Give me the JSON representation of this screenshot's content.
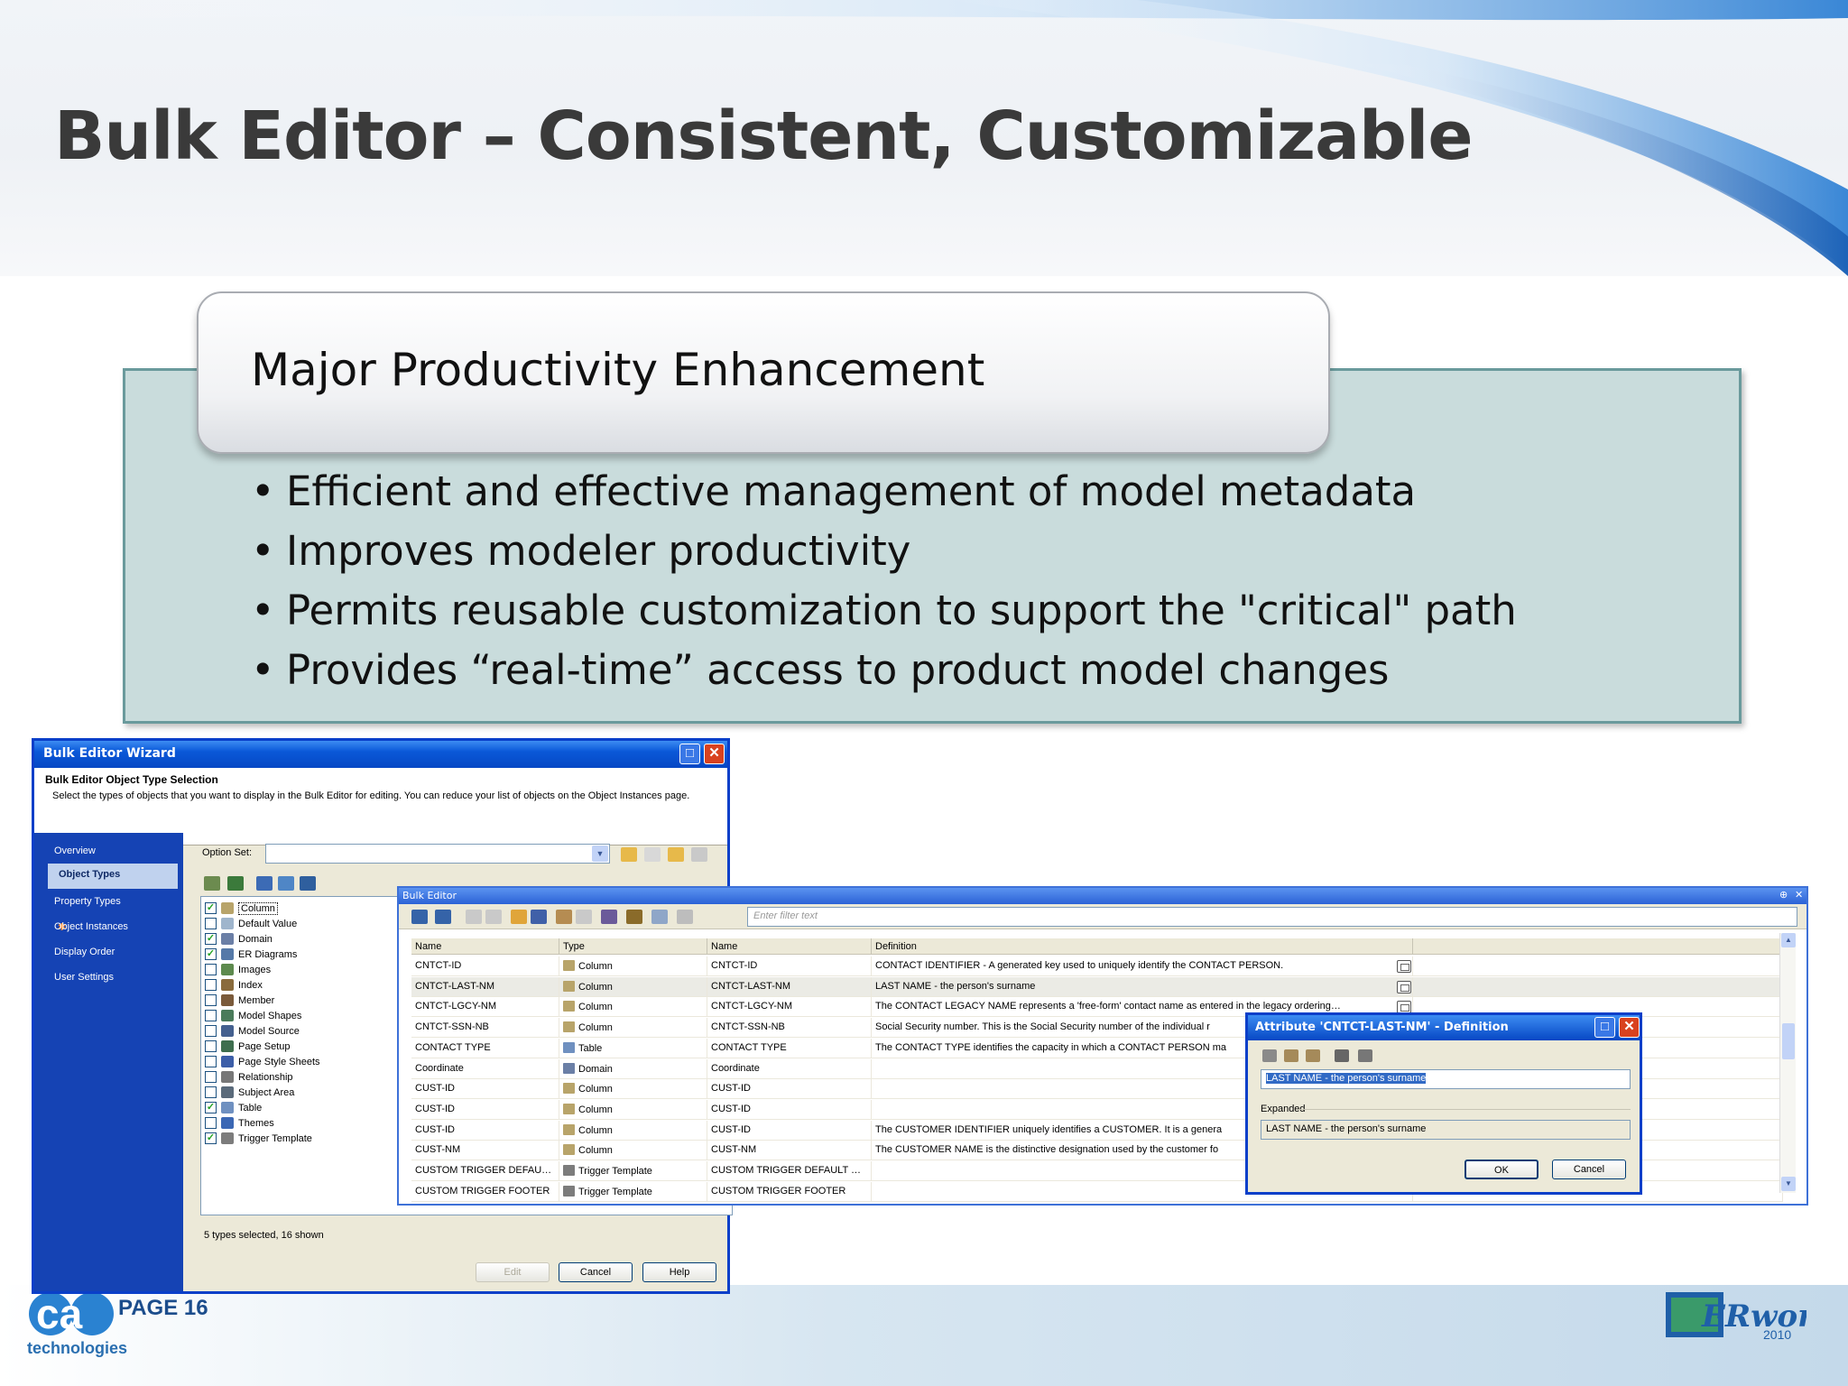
{
  "slide": {
    "title": "Bulk Editor – Consistent, Customizable",
    "tab_heading": "Major Productivity Enhancement",
    "bullets": [
      "Efficient and effective management of model metadata",
      "Improves modeler productivity",
      "Permits reusable customization to support the \"critical\" path",
      "Provides “real-time” access to product model changes"
    ],
    "bullet_symbol": "•",
    "page_label": "PAGE 16",
    "logo_left_text": "ca",
    "logo_left_sub": "technologies",
    "logo_right_text": "ERworld",
    "logo_right_year": "2010"
  },
  "colors": {
    "title": "#3a3a3a",
    "content_box": "#c9dcdc",
    "xp_titlebar": "#0a58d8",
    "wizard_nav": "#1543b4",
    "page_label": "#1c4d8c"
  },
  "wizard": {
    "title": "Bulk Editor Wizard",
    "heading": "Bulk Editor Object Type Selection",
    "description": "Select the types of objects that you want to display in the Bulk Editor for editing. You can reduce your list of objects on the Object Instances page.",
    "nav": [
      "Overview",
      "Object Types",
      "Property Types",
      "Object Instances",
      "Display Order",
      "User Settings"
    ],
    "active_nav": "Object Types",
    "option_set_label": "Option Set:",
    "option_set_value": "",
    "object_types": [
      {
        "label": "Column",
        "checked": true,
        "icon": "column-icon"
      },
      {
        "label": "Default Value",
        "checked": false,
        "icon": "default-value-icon"
      },
      {
        "label": "Domain",
        "checked": true,
        "icon": "domain-icon"
      },
      {
        "label": "ER Diagrams",
        "checked": true,
        "icon": "er-diagram-icon"
      },
      {
        "label": "Images",
        "checked": false,
        "icon": "image-icon"
      },
      {
        "label": "Index",
        "checked": false,
        "icon": "index-icon"
      },
      {
        "label": "Member",
        "checked": false,
        "icon": "member-icon"
      },
      {
        "label": "Model Shapes",
        "checked": false,
        "icon": "model-shapes-icon"
      },
      {
        "label": "Model Source",
        "checked": false,
        "icon": "model-source-icon"
      },
      {
        "label": "Page Setup",
        "checked": false,
        "icon": "page-setup-icon"
      },
      {
        "label": "Page Style Sheets",
        "checked": false,
        "icon": "style-sheet-icon"
      },
      {
        "label": "Relationship",
        "checked": false,
        "icon": "relationship-icon"
      },
      {
        "label": "Subject Area",
        "checked": false,
        "icon": "subject-area-icon"
      },
      {
        "label": "Table",
        "checked": true,
        "icon": "table-icon"
      },
      {
        "label": "Themes",
        "checked": false,
        "icon": "themes-icon"
      },
      {
        "label": "Trigger Template",
        "checked": true,
        "icon": "trigger-template-icon"
      }
    ],
    "status": "5 types selected, 16 shown",
    "buttons": {
      "edit": "Edit",
      "cancel": "Cancel",
      "help": "Help"
    }
  },
  "bulk_editor": {
    "title": "Bulk Editor",
    "filter_placeholder": "Enter filter text",
    "columns": [
      "Name",
      "Type",
      "Name",
      "Definition"
    ],
    "rows": [
      {
        "name": "CNTCT-ID",
        "type": "Column",
        "name2": "CNTCT-ID",
        "definition": "CONTACT IDENTIFIER - A generated key used to uniquely identify the CONTACT PERSON."
      },
      {
        "name": "CNTCT-LAST-NM",
        "type": "Column",
        "name2": "CNTCT-LAST-NM",
        "definition": "LAST NAME - the person's surname"
      },
      {
        "name": "CNTCT-LGCY-NM",
        "type": "Column",
        "name2": "CNTCT-LGCY-NM",
        "definition": "The CONTACT LEGACY NAME represents a 'free-form' contact name as entered in the legacy ordering…"
      },
      {
        "name": "CNTCT-SSN-NB",
        "type": "Column",
        "name2": "CNTCT-SSN-NB",
        "definition": "Social Security number.  This is the Social Security number of the individual r"
      },
      {
        "name": "CONTACT TYPE",
        "type": "Table",
        "name2": "CONTACT TYPE",
        "definition": "The CONTACT TYPE identifies the capacity in which a CONTACT PERSON ma"
      },
      {
        "name": "Coordinate",
        "type": "Domain",
        "name2": "Coordinate",
        "definition": ""
      },
      {
        "name": "CUST-ID",
        "type": "Column",
        "name2": "CUST-ID",
        "definition": ""
      },
      {
        "name": "CUST-ID",
        "type": "Column",
        "name2": "CUST-ID",
        "definition": ""
      },
      {
        "name": "CUST-ID",
        "type": "Column",
        "name2": "CUST-ID",
        "definition": "The CUSTOMER IDENTIFIER uniquely identifies a CUSTOMER.  It is a genera"
      },
      {
        "name": "CUST-NM",
        "type": "Column",
        "name2": "CUST-NM",
        "definition": "The CUSTOMER NAME is the distinctive designation used by the customer fo"
      },
      {
        "name": "CUSTOM TRIGGER DEFAU…",
        "type": "Trigger Template",
        "name2": "CUSTOM TRIGGER DEFAULT …",
        "definition": ""
      },
      {
        "name": "CUSTOM TRIGGER FOOTER",
        "type": "Trigger Template",
        "name2": "CUSTOM TRIGGER FOOTER",
        "definition": ""
      }
    ]
  },
  "attribute_dialog": {
    "title": "Attribute 'CNTCT-LAST-NM' - Definition",
    "definition_value": "LAST NAME - the person's surname",
    "expanded_label": "Expanded",
    "expanded_value": "LAST NAME - the person's surname",
    "ok_label": "OK",
    "cancel_label": "Cancel"
  }
}
